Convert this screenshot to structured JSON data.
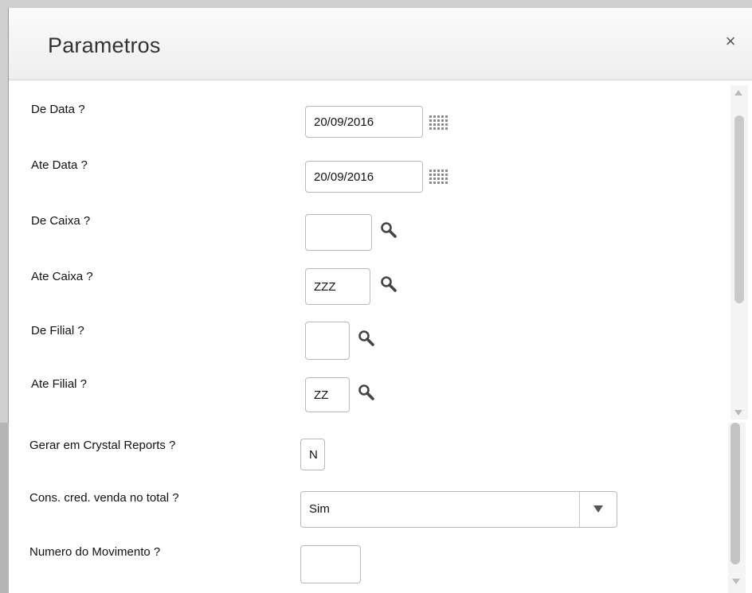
{
  "dialog": {
    "title": "Parametros",
    "close_symbol": "×"
  },
  "params": [
    {
      "label": "De Data ?",
      "value": "20/09/2016",
      "icon": "calendar-icon"
    },
    {
      "label": "Ate Data ?",
      "value": "20/09/2016",
      "icon": "calendar-icon"
    },
    {
      "label": "De Caixa ?",
      "value": "",
      "icon": "search-icon"
    },
    {
      "label": "Ate Caixa ?",
      "value": "ZZZ",
      "icon": "search-icon"
    },
    {
      "label": "De Filial ?",
      "value": "",
      "icon": "search-icon"
    },
    {
      "label": "Ate Filial ?",
      "value": "ZZ",
      "icon": "search-icon"
    }
  ],
  "bottom": {
    "gerar": {
      "label": "Gerar em Crystal Reports ?",
      "value": "N"
    },
    "cons": {
      "label": "Cons. cred. venda no total ?",
      "value": "Sim"
    },
    "numero": {
      "label": "Numero do Movimento ?",
      "value": ""
    }
  }
}
